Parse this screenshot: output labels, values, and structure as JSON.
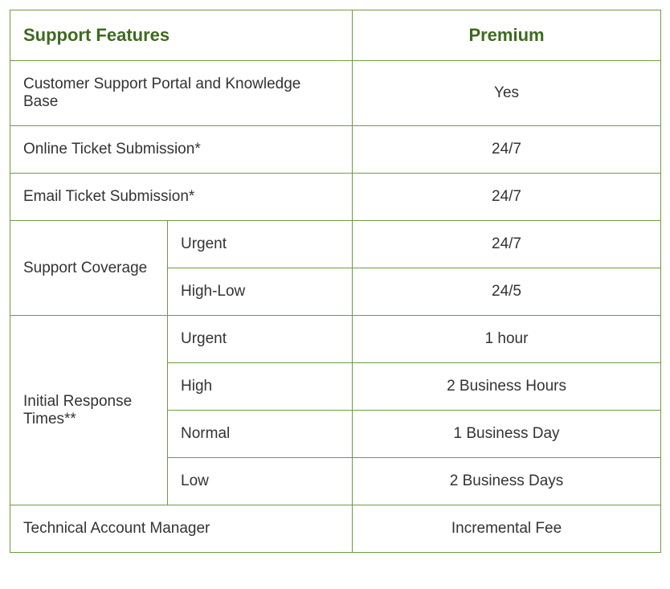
{
  "headers": {
    "features": "Support Features",
    "premium": "Premium"
  },
  "rows": {
    "portal": {
      "label": "Customer Support Portal and Knowledge Base",
      "value": "Yes"
    },
    "online_ticket": {
      "label": "Online Ticket Submission*",
      "value": "24/7"
    },
    "email_ticket": {
      "label": "Email Ticket Submission*",
      "value": "24/7"
    },
    "support_coverage": {
      "label": "Support Coverage",
      "urgent": {
        "label": "Urgent",
        "value": "24/7"
      },
      "high_low": {
        "label": "High-Low",
        "value": "24/5"
      }
    },
    "response_times": {
      "label": "Initial Response Times**",
      "urgent": {
        "label": "Urgent",
        "value": "1 hour"
      },
      "high": {
        "label": "High",
        "value": "2 Business Hours"
      },
      "normal": {
        "label": "Normal",
        "value": "1 Business Day"
      },
      "low": {
        "label": "Low",
        "value": "2 Business Days"
      }
    },
    "tam": {
      "label": "Technical Account Manager",
      "value": "Incremental Fee"
    }
  }
}
